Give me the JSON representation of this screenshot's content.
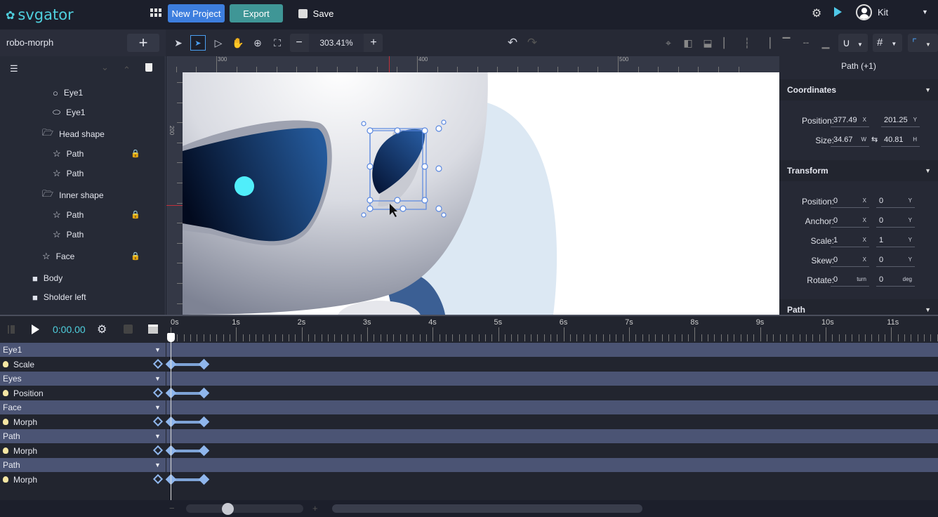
{
  "app": {
    "name": "svgator",
    "brand_color": "#4fd0de"
  },
  "topbar": {
    "apps_icon": "grid-icon",
    "new_project": "New Project",
    "new_project_color": "#3d7ede",
    "export": "Export",
    "export_color": "#3f9696",
    "save": "Save",
    "settings_icon": "gear-play-icon",
    "preview_icon": "play-icon",
    "user": "Kit"
  },
  "project": {
    "name": "robo-morph",
    "add": "+"
  },
  "toolbar": {
    "zoom": "303.41%",
    "zoom_out": "−",
    "zoom_in": "+"
  },
  "layers": [
    {
      "name": "Eye1",
      "icon": "circle",
      "level": 3
    },
    {
      "name": "Eye1",
      "icon": "ellipse",
      "level": 3
    },
    {
      "name": "Head shape",
      "icon": "folder-open",
      "level": 2
    },
    {
      "name": "Path",
      "icon": "star",
      "level": 3,
      "locked": true
    },
    {
      "name": "Path",
      "icon": "star",
      "level": 3
    },
    {
      "name": "Inner shape",
      "icon": "folder-open",
      "level": 2
    },
    {
      "name": "Path",
      "icon": "star",
      "level": 3,
      "locked": true
    },
    {
      "name": "Path",
      "icon": "star",
      "level": 3
    },
    {
      "name": "Face",
      "icon": "star",
      "level": 2,
      "locked": true
    },
    {
      "name": "Body",
      "icon": "folder",
      "level": 1
    },
    {
      "name": "Sholder left",
      "icon": "folder",
      "level": 1
    }
  ],
  "rulers": {
    "top": [
      "300",
      "400",
      "500"
    ],
    "left": [
      "200"
    ]
  },
  "props": {
    "title": "Path (+1)",
    "coordinates": {
      "title": "Coordinates",
      "position_label": "Position:",
      "x": "377.49",
      "y": "201.25",
      "size_label": "Size:",
      "w": "34.67",
      "h": "40.81"
    },
    "transform": {
      "title": "Transform",
      "rows": [
        {
          "label": "Position:",
          "a": "0",
          "ua": "X",
          "b": "0",
          "ub": "Y"
        },
        {
          "label": "Anchor:",
          "a": "0",
          "ua": "X",
          "b": "0",
          "ub": "Y"
        },
        {
          "label": "Scale:",
          "a": "1",
          "ua": "X",
          "b": "1",
          "ub": "Y"
        },
        {
          "label": "Skew:",
          "a": "0",
          "ua": "X",
          "b": "0",
          "ub": "Y"
        },
        {
          "label": "Rotate:",
          "a": "0",
          "ua": "turn",
          "b": "0",
          "ub": "deg"
        }
      ]
    },
    "path": {
      "title": "Path"
    },
    "units": {
      "x": "X",
      "y": "Y",
      "w": "W",
      "h": "H"
    }
  },
  "timeline": {
    "time": "0:00.00",
    "ticks": [
      "0s",
      "1s",
      "2s",
      "3s",
      "4s",
      "5s",
      "6s",
      "7s",
      "8s",
      "9s",
      "10s",
      "11s"
    ],
    "rows": [
      {
        "type": "group",
        "label": "Eye1"
      },
      {
        "type": "prop",
        "label": "Scale",
        "keyframes": [
          0,
          0.5
        ]
      },
      {
        "type": "group",
        "label": "Eyes"
      },
      {
        "type": "prop",
        "label": "Position",
        "keyframes": [
          0,
          0.5
        ]
      },
      {
        "type": "group",
        "label": "Face"
      },
      {
        "type": "prop",
        "label": "Morph",
        "keyframes": [
          0,
          0.5
        ]
      },
      {
        "type": "group",
        "label": "Path"
      },
      {
        "type": "prop",
        "label": "Morph",
        "keyframes": [
          0,
          0.5
        ]
      },
      {
        "type": "group",
        "label": "Path"
      },
      {
        "type": "prop",
        "label": "Morph",
        "keyframes": [
          0,
          0.5
        ]
      }
    ],
    "zoom_minus": "−",
    "zoom_plus": "+"
  }
}
